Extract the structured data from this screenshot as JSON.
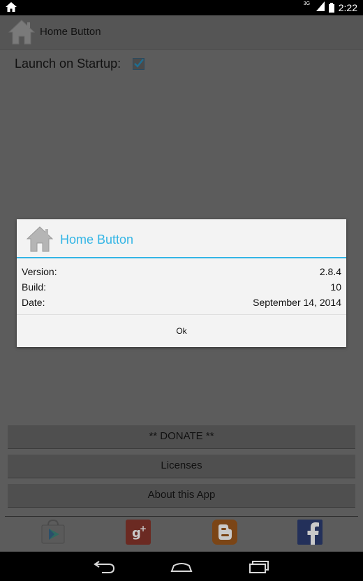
{
  "status_bar": {
    "network": "3G",
    "time": "2:22"
  },
  "app_bar": {
    "title": "Home Button",
    "icon": "house-icon"
  },
  "settings": {
    "launch_label": "Launch on Startup:",
    "launch_checked": true
  },
  "buttons": {
    "donate": "** DONATE **",
    "licenses": "Licenses",
    "about": "About this App"
  },
  "social": [
    "play-store-icon",
    "google-plus-icon",
    "blogger-icon",
    "facebook-icon"
  ],
  "dialog": {
    "title": "Home Button",
    "rows": [
      {
        "key": "Version:",
        "value": "2.8.4"
      },
      {
        "key": "Build:",
        "value": "10"
      },
      {
        "key": "Date:",
        "value": "September 14, 2014"
      }
    ],
    "ok_label": "Ok"
  },
  "colors": {
    "accent": "#33b5e5",
    "dim_background": "#5c5c5c"
  }
}
